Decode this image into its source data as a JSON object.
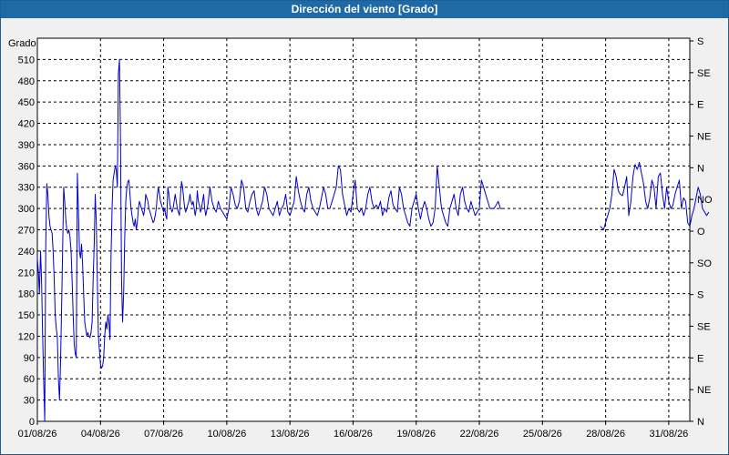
{
  "window": {
    "title": "Dirección del viento [Grado]"
  },
  "colors": {
    "title_bg": "#1f6aa5",
    "title_text": "#ffffff",
    "series": "#0000cc",
    "grid": "#000000",
    "panel_bg": "#f0f0f0",
    "plot_bg": "#ffffff"
  },
  "chart_data": {
    "type": "line",
    "title": "Dirección del viento [Grado]",
    "ylabel": "Grado",
    "xlabel": "",
    "ylim": [
      0,
      540
    ],
    "grid": true,
    "left_ticks": [
      "0",
      "30",
      "60",
      "90",
      "120",
      "150",
      "180",
      "210",
      "240",
      "270",
      "300",
      "330",
      "360",
      "390",
      "420",
      "450",
      "480",
      "510"
    ],
    "right_ticks": [
      "N",
      "NE",
      "E",
      "SE",
      "S",
      "SO",
      "O",
      "NO",
      "N",
      "NE",
      "E",
      "SE",
      "S"
    ],
    "x_ticks": [
      "01/08/26",
      "04/08/26",
      "07/08/26",
      "10/08/26",
      "13/08/26",
      "16/08/26",
      "19/08/26",
      "22/08/26",
      "25/08/26",
      "28/08/26",
      "31/08/26"
    ],
    "x_start": "01/08/26",
    "series": [
      {
        "name": "",
        "segments": [
          {
            "x": [
              0.0,
              0.05,
              0.1,
              0.15,
              0.2,
              0.25,
              0.3,
              0.35,
              0.4,
              0.45,
              0.5,
              0.55,
              0.6,
              0.65,
              0.7,
              0.75,
              0.8,
              0.85,
              0.9,
              0.95,
              1.0,
              1.05,
              1.1,
              1.15,
              1.2,
              1.25,
              1.3,
              1.35,
              1.4,
              1.45,
              1.5,
              1.55,
              1.6,
              1.65,
              1.7,
              1.75,
              1.8,
              1.85,
              1.9,
              1.95,
              2.0,
              2.05,
              2.1,
              2.15,
              2.2,
              2.25,
              2.3,
              2.35,
              2.4,
              2.45,
              2.5,
              2.55,
              2.6,
              2.65,
              2.7,
              2.75,
              2.8,
              2.85,
              2.9,
              2.95,
              3.0,
              3.05,
              3.1,
              3.15,
              3.2,
              3.25,
              3.3,
              3.35,
              3.4,
              3.45,
              3.5,
              3.55,
              3.6,
              3.65,
              3.7,
              3.75,
              3.8,
              3.85,
              3.9,
              3.95,
              4.0,
              4.05,
              4.1,
              4.15,
              4.2,
              4.25,
              4.3,
              4.35,
              4.4,
              4.45,
              4.5,
              4.55,
              4.6,
              4.65,
              4.7,
              4.75,
              4.8,
              4.85,
              4.9,
              4.95,
              5.0,
              5.05,
              5.1,
              5.15,
              5.2,
              5.25,
              5.3,
              5.35,
              5.4,
              5.45,
              5.5,
              5.55,
              5.6,
              5.65,
              5.7,
              5.75,
              5.8,
              5.85,
              5.9,
              5.95,
              6.0,
              6.05,
              6.1,
              6.15,
              6.2,
              6.25,
              6.3,
              6.35,
              6.4,
              6.45,
              6.5,
              6.55,
              6.6,
              6.65,
              6.7,
              6.75,
              6.8,
              6.85,
              6.9,
              6.95,
              7.0,
              7.05,
              7.1,
              7.15,
              7.2,
              7.25,
              7.3,
              7.35,
              7.4,
              7.45,
              7.5,
              7.55,
              7.6,
              7.65,
              7.7,
              7.75,
              7.8,
              7.85,
              7.9,
              7.95,
              8.0,
              8.1,
              8.2,
              8.3,
              8.4,
              8.5,
              8.6,
              8.7,
              8.8,
              8.9,
              9.0,
              9.1,
              9.2,
              9.3,
              9.4,
              9.5,
              9.6,
              9.7,
              9.8,
              9.9,
              10.0,
              10.1,
              10.2,
              10.3,
              10.4,
              10.5,
              10.6,
              10.7,
              10.8,
              10.9,
              11.0,
              11.1,
              11.2,
              11.3,
              11.4,
              11.5,
              11.6,
              11.7,
              11.8,
              11.9,
              12.0,
              12.1,
              12.2,
              12.3,
              12.4,
              12.5,
              12.6,
              12.7,
              12.8,
              12.9,
              13.0,
              13.1,
              13.2,
              13.3,
              13.4,
              13.5,
              13.6,
              13.7,
              13.8,
              13.9,
              14.0,
              14.1,
              14.2,
              14.3,
              14.4,
              14.5,
              14.6,
              14.7,
              14.8,
              14.9,
              15.0,
              15.1,
              15.2,
              15.3,
              15.4,
              15.5,
              15.6,
              15.7,
              15.8,
              15.9,
              16.0,
              16.1,
              16.2,
              16.3,
              16.4,
              16.5,
              16.6,
              16.7,
              16.8,
              16.9,
              17.0,
              17.1,
              17.2,
              17.3,
              17.4,
              17.5,
              17.6,
              17.7,
              17.8,
              17.9,
              18.0,
              18.1,
              18.2,
              18.3,
              18.4,
              18.5,
              18.6,
              18.7,
              18.8,
              18.9,
              19.0,
              19.1,
              19.2,
              19.3,
              19.4,
              19.5,
              19.6,
              19.7,
              19.8,
              19.9,
              20.0,
              20.1,
              20.2,
              20.3,
              20.4,
              20.5,
              20.6,
              20.7,
              20.8,
              20.9,
              21.0,
              21.1,
              21.2,
              21.3,
              21.4,
              21.5,
              21.6,
              21.7,
              21.8,
              21.9,
              22.0,
              22.1,
              22.2,
              22.3,
              22.4,
              22.5,
              22.6,
              22.7,
              22.8,
              22.9,
              23.0,
              23.1,
              23.2,
              23.3,
              23.4,
              23.5,
              23.6,
              23.7,
              23.8,
              23.9,
              24.0,
              24.1,
              24.2,
              24.3,
              24.4,
              24.5,
              24.6,
              24.7,
              24.8,
              24.9,
              25.0,
              25.1,
              25.2,
              25.3,
              25.4,
              25.5,
              25.6,
              25.7,
              25.8,
              25.9,
              26.0,
              26.1,
              26.2,
              26.3
            ],
            "y": [
              230,
              210,
              180,
              240,
              200,
              120,
              60,
              0,
              250,
              335,
              320,
              290,
              275,
              270,
              265,
              240,
              200,
              150,
              130,
              120,
              60,
              30,
              80,
              160,
              240,
              330,
              310,
              285,
              270,
              265,
              270,
              260,
              240,
              200,
              150,
              110,
              95,
              90,
              350,
              300,
              240,
              230,
              250,
              220,
              180,
              140,
              130,
              120,
              125,
              120,
              118,
              125,
              140,
              200,
              250,
              320,
              280,
              200,
              120,
              100,
              80,
              75,
              78,
              90,
              120,
              140,
              130,
              150,
              140,
              115,
              230,
              300,
              340,
              350,
              360,
              355,
              330,
              490,
              510,
              400,
              200,
              140,
              180,
              260,
              310,
              330,
              338,
              340,
              320,
              300,
              290,
              280,
              275,
              285,
              270,
              280,
              300,
              310,
              305,
              300,
              295,
              290,
              300,
              320,
              315,
              310,
              300,
              295,
              290,
              285,
              280,
              283,
              290,
              300,
              320,
              330,
              320,
              310,
              305,
              300,
              295,
              300,
              290,
              285,
              330,
              320,
              305,
              300,
              295,
              300,
              310,
              320,
              310,
              300,
              295,
              290,
              320,
              338,
              330,
              315,
              300,
              295,
              300,
              305,
              310,
              320,
              310,
              305,
              310,
              300,
              290,
              300,
              325,
              310,
              305,
              295,
              300,
              310,
              320,
              300,
              290,
              305,
              330,
              310,
              300,
              295,
              310,
              300,
              295,
              290,
              285,
              300,
              330,
              320,
              305,
              300,
              310,
              340,
              330,
              300,
              295,
              310,
              320,
              325,
              300,
              290,
              300,
              310,
              330,
              320,
              300,
              295,
              290,
              300,
              310,
              290,
              300,
              305,
              320,
              295,
              290,
              300,
              310,
              345,
              325,
              310,
              300,
              295,
              320,
              330,
              310,
              300,
              295,
              290,
              300,
              315,
              330,
              320,
              300,
              300,
              310,
              320,
              330,
              360,
              355,
              320,
              305,
              290,
              300,
              295,
              320,
              340,
              300,
              295,
              300,
              290,
              300,
              320,
              330,
              310,
              300,
              305,
              300,
              310,
              290,
              300,
              295,
              315,
              325,
              305,
              300,
              295,
              330,
              320,
              300,
              290,
              280,
              275,
              300,
              310,
              320,
              300,
              285,
              300,
              310,
              300,
              285,
              275,
              280,
              300,
              360,
              330,
              300,
              290,
              280,
              275,
              300,
              310,
              320,
              300,
              290,
              320,
              330,
              310,
              300,
              295,
              310,
              300,
              290,
              295,
              300,
              340,
              330,
              320,
              310,
              300,
              300,
              300,
              305,
              310,
              300,
              300
            ]
          },
          {
            "x": [
              26.75,
              26.9,
              27.0,
              27.1,
              27.2,
              27.3,
              27.4,
              27.5,
              27.6,
              27.7,
              27.8,
              27.9,
              28.0,
              28.1,
              28.2,
              28.3,
              28.4,
              28.5,
              28.6,
              28.7,
              28.8,
              28.9,
              29.0,
              29.1,
              29.2,
              29.3,
              29.4,
              29.5,
              29.6,
              29.7,
              29.8,
              29.9,
              30.0,
              30.1,
              30.2,
              30.3,
              30.4,
              30.5,
              30.6,
              30.7,
              30.8,
              30.9,
              31.0,
              31.1,
              31.2,
              31.3,
              31.4,
              31.5,
              31.6,
              31.7,
              31.8,
              31.9
            ],
            "y": [
              275,
              270,
              280,
              290,
              300,
              320,
              355,
              345,
              325,
              320,
              318,
              330,
              345,
              290,
              310,
              345,
              362,
              355,
              365,
              350,
              335,
              310,
              300,
              315,
              340,
              330,
              300,
              345,
              350,
              320,
              300,
              330,
              310,
              300,
              305,
              320,
              330,
              340,
              300,
              315,
              310,
              280,
              275,
              290,
              300,
              315,
              330,
              320,
              300,
              295,
              290,
              295
            ]
          }
        ]
      }
    ]
  }
}
